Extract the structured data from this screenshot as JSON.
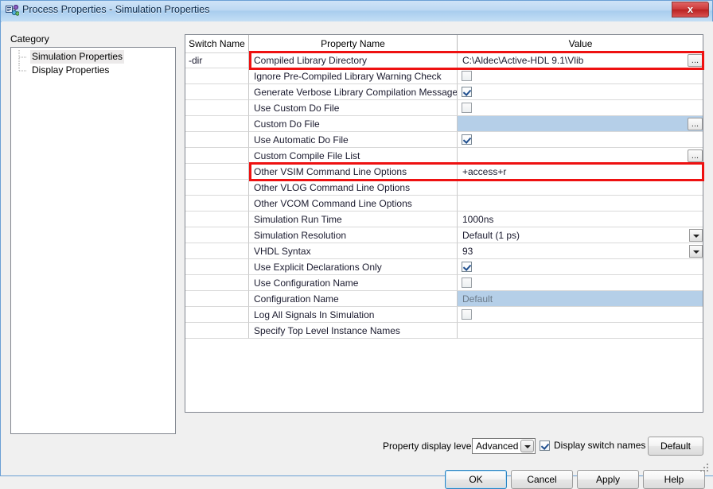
{
  "window": {
    "title": "Process Properties - Simulation Properties",
    "icon": "process-properties-icon",
    "close_label": "x"
  },
  "sidebar": {
    "label": "Category",
    "items": [
      {
        "label": "Simulation Properties",
        "selected": true
      },
      {
        "label": "Display Properties",
        "selected": false
      }
    ]
  },
  "grid": {
    "columns": [
      "Switch Name",
      "Property Name",
      "Value"
    ],
    "rows": [
      {
        "switch": "-dir",
        "property": "Compiled Library Directory",
        "value": "C:\\Aldec\\Active-HDL 9.1\\Vlib",
        "type": "text",
        "browse": true,
        "highlighted": true
      },
      {
        "switch": "",
        "property": "Ignore Pre-Compiled Library Warning Check",
        "value": "",
        "type": "checkbox",
        "checked": false
      },
      {
        "switch": "",
        "property": "Generate Verbose Library Compilation Messages",
        "value": "",
        "type": "checkbox",
        "checked": true
      },
      {
        "switch": "",
        "property": "Use Custom Do File",
        "value": "",
        "type": "checkbox",
        "checked": false
      },
      {
        "switch": "",
        "property": "Custom Do File",
        "value": "",
        "type": "text",
        "browse": true,
        "selected": true
      },
      {
        "switch": "",
        "property": "Use Automatic Do File",
        "value": "",
        "type": "checkbox",
        "checked": true
      },
      {
        "switch": "",
        "property": "Custom Compile File List",
        "value": "",
        "type": "text",
        "browse": true
      },
      {
        "switch": "",
        "property": "Other VSIM Command Line Options",
        "value": "+access+r",
        "type": "text",
        "highlighted": true
      },
      {
        "switch": "",
        "property": "Other VLOG Command Line Options",
        "value": "",
        "type": "text"
      },
      {
        "switch": "",
        "property": "Other VCOM Command Line Options",
        "value": "",
        "type": "text"
      },
      {
        "switch": "",
        "property": "Simulation Run Time",
        "value": "1000ns",
        "type": "text"
      },
      {
        "switch": "",
        "property": "Simulation Resolution",
        "value": "Default (1 ps)",
        "type": "dropdown"
      },
      {
        "switch": "",
        "property": "VHDL Syntax",
        "value": "93",
        "type": "dropdown"
      },
      {
        "switch": "",
        "property": "Use Explicit Declarations Only",
        "value": "",
        "type": "checkbox",
        "checked": true
      },
      {
        "switch": "",
        "property": "Use Configuration Name",
        "value": "",
        "type": "checkbox",
        "checked": false
      },
      {
        "switch": "",
        "property": "Configuration Name",
        "value": "Default",
        "type": "text",
        "selected": true,
        "placeholder": true
      },
      {
        "switch": "",
        "property": "Log All Signals In Simulation",
        "value": "",
        "type": "checkbox",
        "checked": false
      },
      {
        "switch": "",
        "property": "Specify Top Level Instance Names",
        "value": "",
        "type": "text"
      }
    ]
  },
  "footer": {
    "display_level_label": "Property display level:",
    "display_level_value": "Advanced",
    "switch_names_label": "Display switch names",
    "switch_names_checked": true,
    "default_label": "Default"
  },
  "buttons": {
    "ok": "OK",
    "cancel": "Cancel",
    "apply": "Apply",
    "help": "Help"
  },
  "annotations": {
    "color": "#ee1111",
    "boxes": [
      {
        "target": "Compiled Library Directory"
      },
      {
        "target": "Other VSIM Command Line Options"
      }
    ]
  }
}
